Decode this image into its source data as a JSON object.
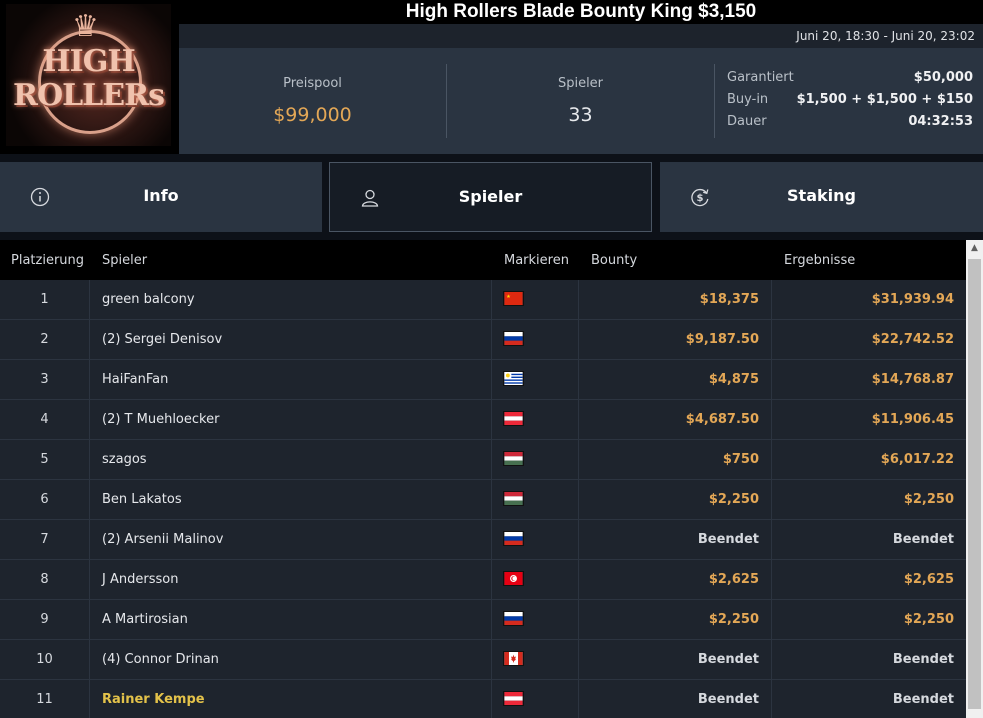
{
  "logo": {
    "line1": "HIGH",
    "line2": "ROLLERs"
  },
  "title": "High Rollers Blade Bounty King $3,150",
  "date_range": "Juni 20, 18:30 - Juni 20, 23:02",
  "stats": {
    "prize_pool_label": "Preispool",
    "prize_pool_value": "$99,000",
    "players_label": "Spieler",
    "players_value": "33",
    "guaranteed_label": "Garantiert",
    "guaranteed_value": "$50,000",
    "buyin_label": "Buy-in",
    "buyin_value": "$1,500 + $1,500 + $150",
    "duration_label": "Dauer",
    "duration_value": "04:32:53"
  },
  "tabs": [
    {
      "label": "Info",
      "icon": "info-icon",
      "active": false
    },
    {
      "label": "Spieler",
      "icon": "user-icon",
      "active": true
    },
    {
      "label": "Staking",
      "icon": "dollar-coin-icon",
      "active": false
    }
  ],
  "table": {
    "headers": {
      "place": "Platzierung",
      "player": "Spieler",
      "mark": "Markieren",
      "bounty": "Bounty",
      "results": "Ergebnisse"
    },
    "rows": [
      {
        "place": "1",
        "player": "green balcony",
        "flag": "china-flag",
        "bounty": "$18,375",
        "result": "$31,939.94",
        "highlight": false
      },
      {
        "place": "2",
        "player": "(2) Sergei Denisov",
        "flag": "russia-flag",
        "bounty": "$9,187.50",
        "result": "$22,742.52",
        "highlight": false
      },
      {
        "place": "3",
        "player": "HaiFanFan",
        "flag": "uruguay-flag",
        "bounty": "$4,875",
        "result": "$14,768.87",
        "highlight": false
      },
      {
        "place": "4",
        "player": "(2) T Muehloecker",
        "flag": "austria-flag",
        "bounty": "$4,687.50",
        "result": "$11,906.45",
        "highlight": false
      },
      {
        "place": "5",
        "player": "szagos",
        "flag": "hungary-flag",
        "bounty": "$750",
        "result": "$6,017.22",
        "highlight": false
      },
      {
        "place": "6",
        "player": "Ben Lakatos",
        "flag": "hungary-flag",
        "bounty": "$2,250",
        "result": "$2,250",
        "highlight": false
      },
      {
        "place": "7",
        "player": "(2) Arsenii Malinov",
        "flag": "russia-flag",
        "bounty": "Beendet",
        "result": "Beendet",
        "highlight": false
      },
      {
        "place": "8",
        "player": "J Andersson",
        "flag": "tunisia-flag",
        "bounty": "$2,625",
        "result": "$2,625",
        "highlight": false
      },
      {
        "place": "9",
        "player": "A Martirosian",
        "flag": "russia-flag",
        "bounty": "$2,250",
        "result": "$2,250",
        "highlight": false
      },
      {
        "place": "10",
        "player": "(4) Connor Drinan",
        "flag": "canada-flag",
        "bounty": "Beendet",
        "result": "Beendet",
        "highlight": false
      },
      {
        "place": "11",
        "player": "Rainer Kempe",
        "flag": "austria-flag",
        "bounty": "Beendet",
        "result": "Beendet",
        "highlight": true
      }
    ]
  },
  "colors": {
    "accent_gold": "#e3a756",
    "highlight_yellow": "#e3c24a",
    "panel": "#2a3441",
    "row_bg": "#1e242d"
  }
}
